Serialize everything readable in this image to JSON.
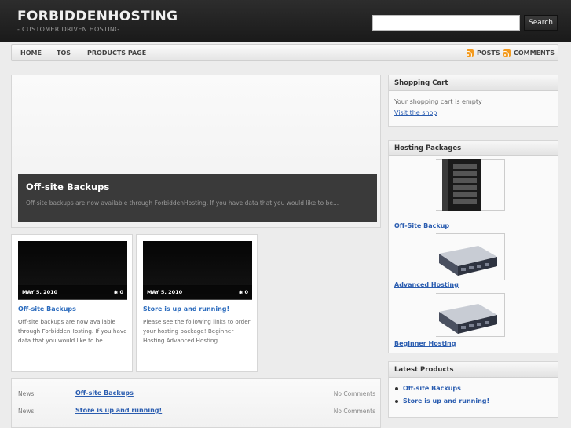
{
  "header": {
    "logo": "FORBIDDENHOSTING",
    "tagline": "- CUSTOMER DRIVEN HOSTING",
    "search_placeholder": "",
    "search_button": "Search"
  },
  "nav": {
    "items": [
      "HOME",
      "TOS",
      "PRODUCTS PAGE"
    ],
    "feeds": [
      "POSTS",
      "COMMENTS"
    ]
  },
  "featured": {
    "title": "Off-site Backups",
    "excerpt": "Off-site backups are now available through ForbiddenHosting. If you have data that you would like to be..."
  },
  "posts": [
    {
      "date": "MAY 5, 2010",
      "comments": "0",
      "title": "Off-site Backups",
      "excerpt": "Off-site backups are now available through ForbiddenHosting. If you have data that you would like to be..."
    },
    {
      "date": "MAY 5, 2010",
      "comments": "0",
      "title": "Store is up and running!",
      "excerpt": "Please see the following links to order your hosting package! Beginner Hosting Advanced Hosting..."
    }
  ],
  "recent": [
    {
      "category": "News",
      "title": "Off-site Backups",
      "comments": "No Comments"
    },
    {
      "category": "News",
      "title": "Store is up and running!",
      "comments": "No Comments"
    }
  ],
  "sidebar": {
    "cart": {
      "title": "Shopping Cart",
      "text": "Your shopping cart is empty",
      "link": "Visit the shop"
    },
    "packages": {
      "title": "Hosting Packages",
      "items": [
        "Off-Site Backup",
        "Advanced Hosting",
        "Beginner Hosting"
      ]
    },
    "latest": {
      "title": "Latest Products",
      "items": [
        "Off-site Backups",
        "Store is up and running!"
      ]
    }
  },
  "colors": {
    "accent": "#2b5db0",
    "header_bg": "#1f1f1f",
    "rss": "#f39a1e"
  }
}
